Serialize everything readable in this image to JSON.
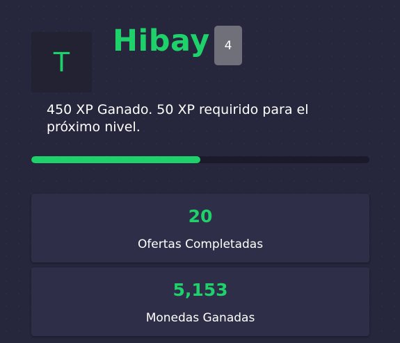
{
  "profile": {
    "avatar_letter": "T",
    "username": "Hibay",
    "level": "4"
  },
  "xp": {
    "text": "450 XP Ganado. 50 XP requirido para el próximo nivel.",
    "progress_fraction": 0.5
  },
  "stats": [
    {
      "value": "20",
      "label": "Ofertas Completadas"
    },
    {
      "value": "5,153",
      "label": "Monedas Ganadas"
    }
  ],
  "colors": {
    "background": "#26263c",
    "card": "#2e2e48",
    "accent": "#1fd16a",
    "badge": "#6f7079",
    "track": "#1a1a2b"
  }
}
